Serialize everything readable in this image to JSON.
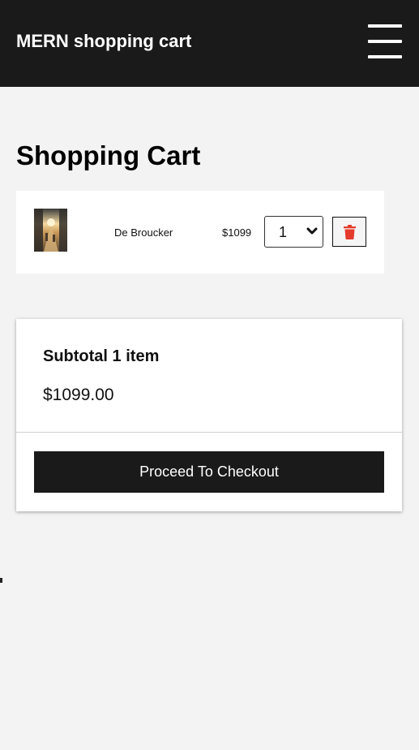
{
  "navbar": {
    "brand": "MERN shopping cart",
    "menu_icon": "hamburger-menu-icon"
  },
  "page": {
    "title": "Shopping Cart"
  },
  "cart": {
    "items": [
      {
        "name": "De Broucker",
        "price": "$1099",
        "quantity": "1",
        "thumbnail_icon": "product-thumbnail",
        "delete_icon": "trash-icon"
      }
    ]
  },
  "summary": {
    "subtotal_label": "Subtotal 1 item",
    "subtotal_amount": "$1099.00",
    "checkout_label": "Proceed To Checkout"
  },
  "colors": {
    "navbar_bg": "#1a1a1a",
    "page_bg": "#f3f3f3",
    "delete_icon": "#e53b2c",
    "button_bg": "#1a1a1a"
  }
}
